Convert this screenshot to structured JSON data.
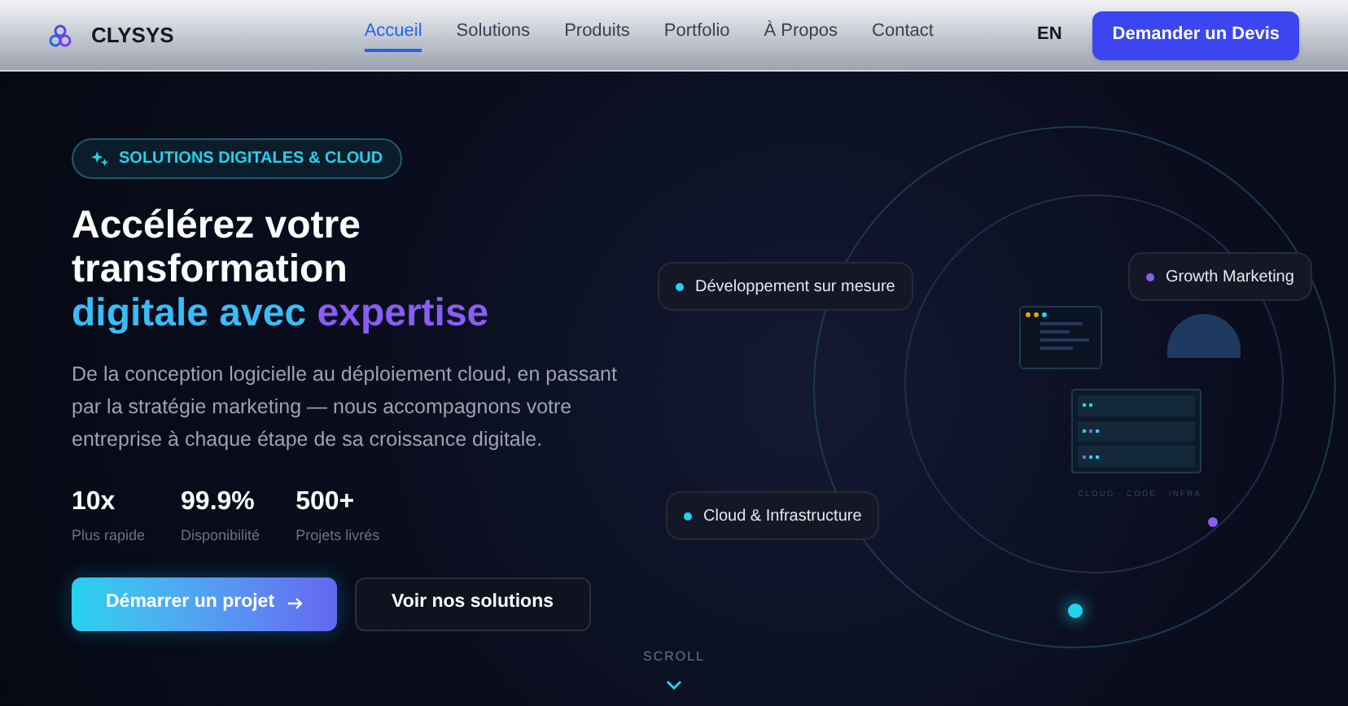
{
  "header": {
    "brand": "CLYSYS",
    "nav": [
      {
        "label": "Accueil",
        "selected": true
      },
      {
        "label": "Solutions",
        "selected": false
      },
      {
        "label": "Produits",
        "selected": false
      },
      {
        "label": "Portfolio",
        "selected": false
      },
      {
        "label": "À Propos",
        "selected": false
      },
      {
        "label": "Contact",
        "selected": false
      }
    ],
    "language": "EN",
    "cta": "Demander un Devis"
  },
  "hero": {
    "badge": "SOLUTIONS DIGITALES & CLOUD",
    "title_lines": [
      "Accélérez votre",
      "transformation"
    ],
    "title_highlight": [
      {
        "text": "digitale avec",
        "color": "#38bdf8"
      },
      {
        "text": "expertise",
        "color": "#8b5cf6"
      }
    ],
    "description": "De la conception logicielle au déploiement cloud, en passant par la stratégie marketing — nous accompagnons votre entreprise à chaque étape de sa croissance digitale.",
    "stats": [
      {
        "value": "10x",
        "label": "Plus rapide"
      },
      {
        "value": "99.9%",
        "label": "Disponibilité"
      },
      {
        "value": "500+",
        "label": "Projets livrés"
      }
    ],
    "buttons": [
      {
        "label": "Démarrer un projet",
        "kind": "primary"
      },
      {
        "label": "Voir nos solutions",
        "kind": "secondary"
      }
    ],
    "scroll": "SCROLL"
  },
  "illustration": {
    "chips": [
      {
        "label": "Développement sur mesure",
        "color": "#22d3ee"
      },
      {
        "label": "Growth Marketing",
        "color": "#8b5cf6"
      },
      {
        "label": "Cloud & Infrastructure",
        "color": "#22d3ee"
      }
    ],
    "caption": "CLOUD · CODE · INFRA"
  }
}
